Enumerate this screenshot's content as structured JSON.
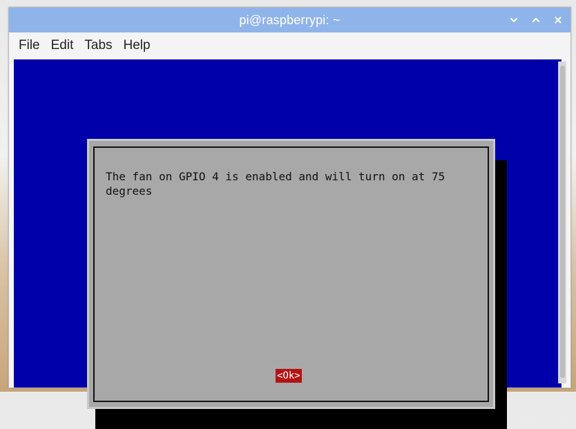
{
  "window": {
    "title": "pi@raspberrypi: ~"
  },
  "menubar": {
    "items": [
      {
        "label": "File"
      },
      {
        "label": "Edit"
      },
      {
        "label": "Tabs"
      },
      {
        "label": "Help"
      }
    ]
  },
  "dialog": {
    "message": "The fan on GPIO 4 is enabled and will turn on at 75\ndegrees",
    "ok_label": "<Ok>"
  },
  "icons": {
    "minimize": "chevron-down-icon",
    "maximize": "chevron-up-icon",
    "close": "close-icon"
  },
  "colors": {
    "titlebar": "#8fb4e9",
    "terminal_bg": "#0000aa",
    "dialog_bg": "#a8a8a8",
    "ok_bg": "#b21414"
  }
}
